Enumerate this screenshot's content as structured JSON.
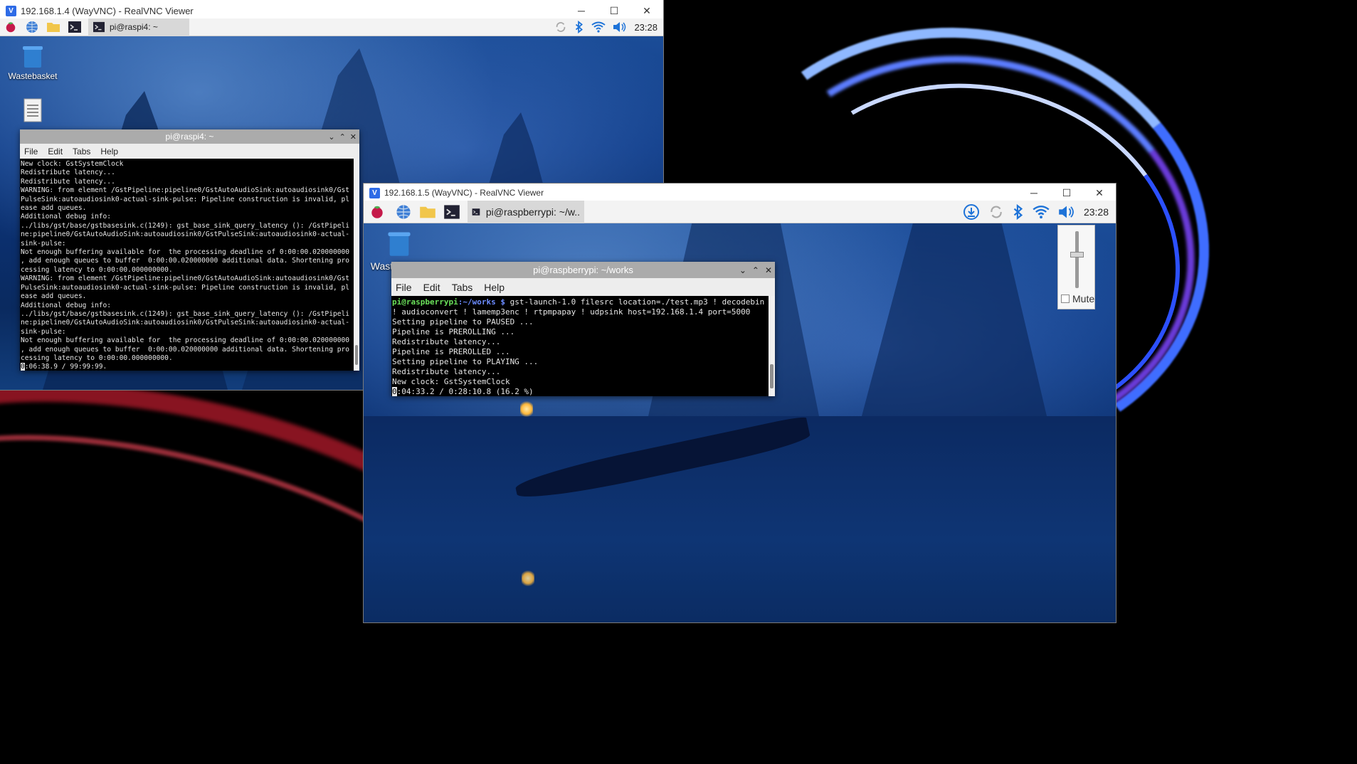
{
  "window1": {
    "title": "192.168.1.4 (WayVNC) - RealVNC Viewer",
    "logo": "V",
    "controls": {
      "minimize": "─",
      "maximize": "☐",
      "close": "✕"
    },
    "pi": {
      "active_task": "pi@raspi4: ~",
      "clock": "23:28",
      "desktop_icons": [
        {
          "label": "Wastebasket"
        },
        {
          "label": ""
        }
      ],
      "terminal": {
        "title": "pi@raspi4: ~",
        "menu": [
          "File",
          "Edit",
          "Tabs",
          "Help"
        ],
        "lines": [
          "New clock: GstSystemClock",
          "Redistribute latency...",
          "Redistribute latency...",
          "WARNING: from element /GstPipeline:pipeline0/GstAutoAudioSink:autoaudiosink0/Gst",
          "PulseSink:autoaudiosink0-actual-sink-pulse: Pipeline construction is invalid, pl",
          "ease add queues.",
          "Additional debug info:",
          "../libs/gst/base/gstbasesink.c(1249): gst_base_sink_query_latency (): /GstPipeli",
          "ne:pipeline0/GstAutoAudioSink:autoaudiosink0/GstPulseSink:autoaudiosink0-actual-",
          "sink-pulse:",
          "Not enough buffering available for  the processing deadline of 0:00:00.020000000",
          ", add enough queues to buffer  0:00:00.020000000 additional data. Shortening pro",
          "cessing latency to 0:00:00.000000000.",
          "WARNING: from element /GstPipeline:pipeline0/GstAutoAudioSink:autoaudiosink0/Gst",
          "PulseSink:autoaudiosink0-actual-sink-pulse: Pipeline construction is invalid, pl",
          "ease add queues.",
          "Additional debug info:",
          "../libs/gst/base/gstbasesink.c(1249): gst_base_sink_query_latency (): /GstPipeli",
          "ne:pipeline0/GstAutoAudioSink:autoaudiosink0/GstPulseSink:autoaudiosink0-actual-",
          "sink-pulse:",
          "Not enough buffering available for  the processing deadline of 0:00:00.020000000",
          ", add enough queues to buffer  0:00:00.020000000 additional data. Shortening pro",
          "cessing latency to 0:00:00.000000000."
        ],
        "cursor_char": "0",
        "status_line": ":06:38.9 / 99:99:99."
      }
    }
  },
  "window2": {
    "title": "192.168.1.5 (WayVNC) - RealVNC Viewer",
    "logo": "V",
    "controls": {
      "minimize": "─",
      "maximize": "☐",
      "close": "✕"
    },
    "pi": {
      "active_task": "pi@raspberrypi: ~/w..",
      "clock": "23:28",
      "desktop_icons": [
        {
          "label": "Wastebasket"
        }
      ],
      "volume": {
        "mute_label": "Mute",
        "level": 0.6
      },
      "terminal": {
        "title": "pi@raspberrypi: ~/works",
        "menu": [
          "File",
          "Edit",
          "Tabs",
          "Help"
        ],
        "prompt_user": "pi@raspberrypi",
        "prompt_path": ":~/works $",
        "command": " gst-launch-1.0 filesrc location=./test.mp3 ! decodebin",
        "command_cont": "! audioconvert ! lamemp3enc ! rtpmpapay ! udpsink host=192.168.1.4 port=5000",
        "lines": [
          "Setting pipeline to PAUSED ...",
          "Pipeline is PREROLLING ...",
          "Redistribute latency...",
          "Pipeline is PREROLLED ...",
          "Setting pipeline to PLAYING ...",
          "Redistribute latency...",
          "New clock: GstSystemClock"
        ],
        "cursor_char": "0",
        "status_line": ":04:33.2 / 0:28:10.8 (16.2 %)"
      }
    }
  },
  "icons": {
    "raspberry": "raspberry-menu-icon",
    "browser": "web-browser-icon",
    "files": "file-manager-icon",
    "terminal": "terminal-icon",
    "update": "update-download-icon",
    "sync": "sync-icon",
    "bluetooth": "bluetooth-icon",
    "wifi": "wifi-icon",
    "volume": "volume-icon"
  },
  "colors": {
    "accent": "#2e6be6",
    "raspberry": "#c51a4a",
    "terminal_green": "#6ae05a",
    "terminal_blue": "#6b8bff"
  }
}
